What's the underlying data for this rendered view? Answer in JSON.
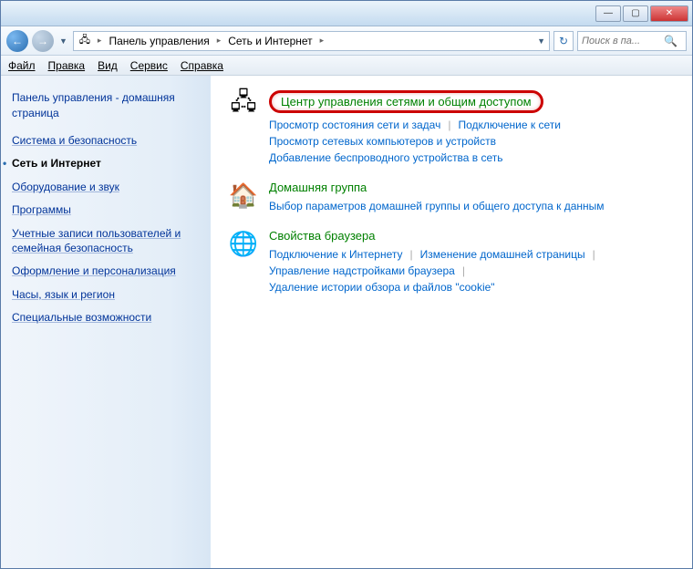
{
  "titlebar": {
    "minimize": "—",
    "maximize": "▢",
    "close": "✕"
  },
  "nav": {
    "back": "←",
    "forward": "→",
    "dropdown": "▼",
    "refresh": "↻"
  },
  "breadcrumb": {
    "icon": "🖧",
    "items": [
      "Панель управления",
      "Сеть и Интернет"
    ],
    "sep": "▸"
  },
  "search": {
    "placeholder": "Поиск в па...",
    "icon": "🔍"
  },
  "menubar": {
    "file": "Файл",
    "edit": "Правка",
    "view": "Вид",
    "tools": "Сервис",
    "help": "Справка"
  },
  "sidebar": {
    "home": "Панель управления - домашняя страница",
    "items": [
      {
        "label": "Система и безопасность",
        "active": false
      },
      {
        "label": "Сеть и Интернет",
        "active": true
      },
      {
        "label": "Оборудование и звук",
        "active": false
      },
      {
        "label": "Программы",
        "active": false
      },
      {
        "label": "Учетные записи пользователей и семейная безопасность",
        "active": false
      },
      {
        "label": "Оформление и персонализация",
        "active": false
      },
      {
        "label": "Часы, язык и регион",
        "active": false
      },
      {
        "label": "Специальные возможности",
        "active": false
      }
    ]
  },
  "main": {
    "sections": [
      {
        "icon": "🖧",
        "title": "Центр управления сетями и общим доступом",
        "highlighted": true,
        "links": [
          "Просмотр состояния сети и задач",
          "Подключение к сети",
          "Просмотр сетевых компьютеров и устройств",
          "Добавление беспроводного устройства в сеть"
        ]
      },
      {
        "icon": "🏠",
        "title": "Домашняя группа",
        "highlighted": false,
        "links": [
          "Выбор параметров домашней группы и общего доступа к данным"
        ]
      },
      {
        "icon": "🌐",
        "title": "Свойства браузера",
        "highlighted": false,
        "links": [
          "Подключение к Интернету",
          "Изменение домашней страницы",
          "Управление надстройками браузера",
          "Удаление истории обзора и файлов \"cookie\""
        ]
      }
    ]
  }
}
